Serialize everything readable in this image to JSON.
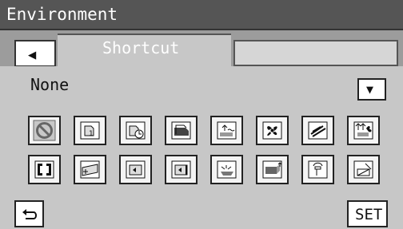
{
  "window": {
    "title": "Environment"
  },
  "tabs": {
    "back_symbol": "◀",
    "current": "Shortcut"
  },
  "selection": {
    "current_value": "None",
    "dropdown_symbol": "▼"
  },
  "icons": [
    {
      "name": "none-icon"
    },
    {
      "name": "single-document-icon"
    },
    {
      "name": "timer-document-icon"
    },
    {
      "name": "stacked-document-icon"
    },
    {
      "name": "paper-output-icon"
    },
    {
      "name": "fan-icon"
    },
    {
      "name": "signature-icon"
    },
    {
      "name": "transfer-settings-icon"
    },
    {
      "name": "bracket-icon"
    },
    {
      "name": "paper-cassette-icon"
    },
    {
      "name": "left-page-icon"
    },
    {
      "name": "right-page-icon"
    },
    {
      "name": "paper-feed-icon"
    },
    {
      "name": "output-tray-icon"
    },
    {
      "name": "stamp-icon"
    },
    {
      "name": "toner-icon"
    }
  ],
  "actions": {
    "set_label": "SET"
  }
}
